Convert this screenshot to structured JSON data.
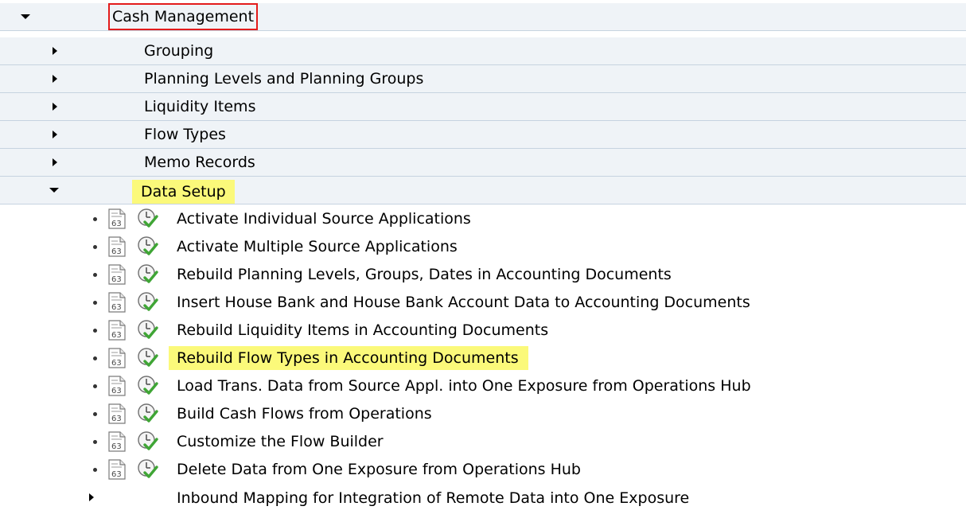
{
  "tree": {
    "root": {
      "label": "Cash Management",
      "expanded": true
    },
    "folders": [
      {
        "label": "Grouping",
        "expanded": false
      },
      {
        "label": "Planning Levels and Planning Groups",
        "expanded": false
      },
      {
        "label": "Liquidity Items",
        "expanded": false
      },
      {
        "label": "Flow Types",
        "expanded": false
      },
      {
        "label": "Memo Records",
        "expanded": false
      },
      {
        "label": "Data Setup",
        "expanded": true,
        "highlighted": true
      }
    ],
    "activities": [
      {
        "label": "Activate Individual Source Applications",
        "icons": [
          "documentation-icon",
          "execute-icon"
        ]
      },
      {
        "label": "Activate Multiple Source Applications",
        "icons": [
          "documentation-icon",
          "execute-icon"
        ]
      },
      {
        "label": "Rebuild Planning Levels, Groups, Dates in Accounting Documents",
        "icons": [
          "documentation-icon",
          "execute-icon"
        ]
      },
      {
        "label": "Insert House Bank and House Bank Account Data to Accounting Documents",
        "icons": [
          "documentation-icon",
          "execute-icon"
        ]
      },
      {
        "label": "Rebuild Liquidity Items in Accounting Documents",
        "icons": [
          "documentation-icon",
          "execute-icon"
        ]
      },
      {
        "label": "Rebuild Flow Types in Accounting Documents",
        "icons": [
          "documentation-icon",
          "execute-icon"
        ],
        "highlighted": true
      },
      {
        "label": "Load Trans. Data from Source Appl. into One Exposure from Operations Hub",
        "icons": [
          "documentation-icon",
          "execute-icon"
        ]
      },
      {
        "label": "Build Cash Flows from Operations",
        "icons": [
          "documentation-icon",
          "execute-icon"
        ]
      },
      {
        "label": "Customize the Flow Builder",
        "icons": [
          "documentation-icon",
          "execute-icon"
        ]
      },
      {
        "label": "Delete Data from One Exposure from Operations Hub",
        "icons": [
          "documentation-icon",
          "execute-icon"
        ]
      }
    ],
    "subfolder": {
      "label": "Inbound Mapping for Integration of Remote Data into One Exposure",
      "expanded": false
    }
  },
  "colors": {
    "folder_background": "#eff3f7",
    "highlight": "#fbf97a",
    "focus_border": "#e31b1b",
    "execute_green": "#3fa535"
  }
}
